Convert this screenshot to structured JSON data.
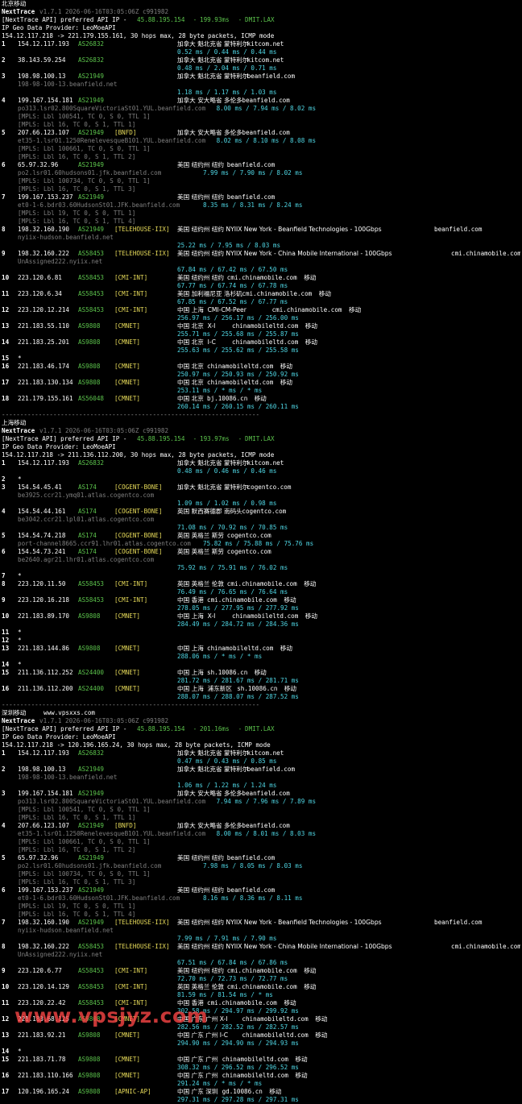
{
  "colors": {
    "green": "#5cc44c",
    "yellow": "#e8dc5a",
    "cyan": "#4fd6e4",
    "gray": "#7f7f7f",
    "red_watermark": "#ff4646"
  },
  "watermark": "www.vpsjyz.com",
  "sections": [
    {
      "title": "北京移动",
      "title_extra": "",
      "header_ver": "v1.7.1 2026-06-16T03:05:06Z c991982",
      "api_ip": "45.88.195.154",
      "api_ms": "199.93ms",
      "api_loc": "DMIT.LAX",
      "provider": "IP Geo Data Provider: LeoMoeAPI",
      "trace": "154.12.117.218 -> 221.179.155.161, 30 hops max, 28 byte packets, ICMP mode",
      "hops": [
        {
          "n": "1",
          "ip": "154.12.117.193",
          "as": "AS26832",
          "tag": "",
          "geo": "加拿大 魁北克省 蒙特利尔",
          "host": "kitcom.net",
          "isp": "",
          "rtt": "0.52 ms / 0.44 ms / 0.44 ms",
          "extra": []
        },
        {
          "n": "2",
          "ip": "38.143.59.254",
          "as": "AS26832",
          "tag": "",
          "geo": "加拿大 魁北克省 蒙特利尔",
          "host": "kitcom.net",
          "isp": "",
          "rtt": "0.48 ms / 2.04 ms / 0.71 ms",
          "extra": []
        },
        {
          "n": "3",
          "ip": "198.98.100.13",
          "as": "AS21949",
          "tag": "",
          "geo": "加拿大 魁北克省 蒙特利尔",
          "host": "beanfield.com",
          "isp": "",
          "rtt": "1.18 ms / 1.17 ms / 1.03 ms",
          "rdns": "198-98-100-13.beanfield.net",
          "extra": []
        },
        {
          "n": "4",
          "ip": "199.167.154.181",
          "as": "AS21949",
          "tag": "",
          "geo": "加拿大 安大略省 多伦多",
          "host": "beanfield.com",
          "isp": "",
          "rtt": "8.00 ms / 7.94 ms / 8.02 ms",
          "rdns": "po313.lsr02.800SquareVictoriaSt01.YUL.beanfield.com",
          "rtt_inline": true,
          "extra": [
            "[MPLS: Lbl 100541, TC 0, S 0, TTL 1]",
            "[MPLS: Lbl 16, TC 0, S 1, TTL 1]"
          ]
        },
        {
          "n": "5",
          "ip": "207.66.123.107",
          "as": "AS21949",
          "tag": "[BNFD]",
          "geo": "加拿大 安大略省 多伦多",
          "host": "beanfield.com",
          "isp": "",
          "rtt": "8.02 ms / 8.10 ms / 8.08 ms",
          "rdns": "et35-1.lsr01.1250RenelevesqueB101.YUL.beanfield.com",
          "rtt_inline": true,
          "extra": [
            "[MPLS: Lbl 100661, TC 0, S 0, TTL 1]",
            "[MPLS: Lbl 16, TC 0, S 1, TTL 2]"
          ]
        },
        {
          "n": "6",
          "ip": "65.97.32.96",
          "as": "AS21949",
          "tag": "",
          "geo": "美国 纽约州 纽约",
          "host": "beanfield.com",
          "isp": "",
          "rtt": "7.99 ms / 7.90 ms / 8.02 ms",
          "rdns": "po2.lsr01.60hudsons01.jfk.beanfield.com",
          "rtt_inline": true,
          "extra": [
            "[MPLS: Lbl 100734, TC 0, S 0, TTL 1]",
            "[MPLS: Lbl 16, TC 0, S 1, TTL 3]"
          ]
        },
        {
          "n": "7",
          "ip": "199.167.153.237",
          "as": "AS21949",
          "tag": "",
          "geo": "美国 纽约州 纽约",
          "host": "beanfield.com",
          "isp": "",
          "rtt": "8.35 ms / 8.31 ms / 8.24 ms",
          "rdns": "et0-1-6.bdr03.60HudsonSt01.JFK.beanfield.com",
          "rtt_inline": true,
          "extra": [
            "[MPLS: Lbl 19, TC 0, S 0, TTL 1]",
            "[MPLS: Lbl 16, TC 0, S 1, TTL 4]"
          ]
        },
        {
          "n": "8",
          "ip": "198.32.160.190",
          "as": "AS21949",
          "tag": "[TELEHOUSE-IIX]",
          "geo": "美国 纽约州 纽约 NYIIX New York - Beanfield Technologies - 100Gbps",
          "host": "beanfield.com",
          "isp": "",
          "rtt": "25.22 ms / 7.95 ms / 8.03 ms",
          "rdns": "nyiix-hudson.beanfield.net",
          "extra": []
        },
        {
          "n": "9",
          "ip": "198.32.160.222",
          "as": "AS58453",
          "tag": "[TELEHOUSE-IIX]",
          "geo": "美国 纽约州 纽约 NYIIX New York - China Mobile International - 100Gbps",
          "host": "cmi.chinamobile.com",
          "isp": "",
          "rtt": "67.84 ms / 67.42 ms / 67.50 ms",
          "rdns": "UnAssigned222.nyiix.net",
          "extra": []
        },
        {
          "n": "10",
          "ip": "223.120.6.81",
          "as": "AS58453",
          "tag": "[CMI-INT]",
          "geo": "美国 纽约州 纽约",
          "host": "cmi.chinamobile.com",
          "isp": "移动",
          "rtt": "67.77 ms / 67.74 ms / 67.78 ms",
          "extra": []
        },
        {
          "n": "11",
          "ip": "223.120.6.34",
          "as": "AS58453",
          "tag": "[CMI-INT]",
          "geo": "美国 加利福尼亚 洛杉矶",
          "host": "cmi.chinamobile.com",
          "isp": "移动",
          "rtt": "67.85 ms / 67.52 ms / 67.77 ms",
          "extra": []
        },
        {
          "n": "12",
          "ip": "223.120.12.214",
          "as": "AS58453",
          "tag": "[CMI-INT]",
          "geo": "中国 上海  CMI-CM-Peer",
          "host": "cmi.chinamobile.com",
          "isp": "移动",
          "rtt": "256.97 ms / 256.17 ms / 256.00 ms",
          "extra": []
        },
        {
          "n": "13",
          "ip": "221.183.55.110",
          "as": "AS9808",
          "tag": "[CMNET]",
          "geo": "中国 北京  X-I",
          "host": "chinamobileltd.com",
          "isp": "移动",
          "rtt": "255.71 ms / 255.68 ms / 255.87 ms",
          "extra": []
        },
        {
          "n": "14",
          "ip": "221.183.25.201",
          "as": "AS9808",
          "tag": "[CMNET]",
          "geo": "中国 北京  I-C",
          "host": "chinamobileltd.com",
          "isp": "移动",
          "rtt": "255.63 ms / 255.62 ms / 255.58 ms",
          "extra": []
        },
        {
          "n": "15",
          "star": true
        },
        {
          "n": "16",
          "ip": "221.183.46.174",
          "as": "AS9808",
          "tag": "[CMNET]",
          "geo": "中国 北京",
          "host": "chinamobileltd.com",
          "isp": "移动",
          "rtt": "250.97 ms / 250.93 ms / 250.92 ms",
          "extra": []
        },
        {
          "n": "17",
          "ip": "221.183.130.134",
          "as": "AS9808",
          "tag": "[CMNET]",
          "geo": "中国 北京",
          "host": "chinamobileltd.com",
          "isp": "移动",
          "rtt": "253.11 ms / * ms / * ms",
          "extra": []
        },
        {
          "n": "18",
          "ip": "221.179.155.161",
          "as": "AS56048",
          "tag": "[CMNET]",
          "geo": "中国 北京",
          "host": "bj.10086.cn",
          "isp": "移动",
          "rtt": "260.14 ms / 260.15 ms / 260.11 ms",
          "extra": []
        }
      ]
    },
    {
      "title": "上海移动",
      "title_extra": "",
      "header_ver": "v1.7.1 2026-06-16T03:05:06Z c991982",
      "api_ip": "45.88.195.154",
      "api_ms": "193.97ms",
      "api_loc": "DMIT.LAX",
      "provider": "IP Geo Data Provider: LeoMoeAPI",
      "trace": "154.12.117.218 -> 211.136.112.200, 30 hops max, 28 byte packets, ICMP mode",
      "hops": [
        {
          "n": "1",
          "ip": "154.12.117.193",
          "as": "AS26832",
          "tag": "",
          "geo": "加拿大 魁北克省 蒙特利尔",
          "host": "kitcom.net",
          "isp": "",
          "rtt": "0.48 ms / 0.46 ms / 0.46 ms",
          "extra": []
        },
        {
          "n": "2",
          "star": true
        },
        {
          "n": "3",
          "ip": "154.54.45.41",
          "as": "AS174",
          "tag": "[COGENT-BONE]",
          "geo": "加拿大 魁北克省 蒙特利尔",
          "host": "cogentco.com",
          "isp": "",
          "rtt": "1.09 ms / 1.02 ms / 0.98 ms",
          "rdns": "be3925.ccr21.ymq01.atlas.cogentco.com",
          "extra": []
        },
        {
          "n": "4",
          "ip": "154.54.44.161",
          "as": "AS174",
          "tag": "[COGENT-BONE]",
          "geo": "英国 默西赛德郡 南码头",
          "host": "cogentco.com",
          "isp": "",
          "rtt": "71.08 ms / 70.92 ms / 70.85 ms",
          "rdns": "be3042.ccr21.lpl01.atlas.cogentco.com",
          "extra": []
        },
        {
          "n": "5",
          "ip": "154.54.74.218",
          "as": "AS174",
          "tag": "[COGENT-BONE]",
          "geo": "英国 英格兰 斯劳",
          "host": "cogentco.com",
          "isp": "",
          "rtt": "75.82 ms / 75.88 ms / 75.76 ms",
          "rdns": "port-channel8665.ccr91.lhr01.atlas.cogentco.com",
          "rtt_inline": true,
          "extra": []
        },
        {
          "n": "6",
          "ip": "154.54.73.241",
          "as": "AS174",
          "tag": "[COGENT-BONE]",
          "geo": "英国 英格兰 斯劳",
          "host": "cogentco.com",
          "isp": "",
          "rtt": "75.92 ms / 75.91 ms / 76.02 ms",
          "rdns": "be2640.agr21.lhr01.atlas.cogentco.com",
          "extra": []
        },
        {
          "n": "7",
          "star": true
        },
        {
          "n": "8",
          "ip": "223.120.11.50",
          "as": "AS58453",
          "tag": "[CMI-INT]",
          "geo": "英国 英格兰 伦敦",
          "host": "cmi.chinamobile.com",
          "isp": "移动",
          "rtt": "76.49 ms / 76.65 ms / 76.64 ms",
          "extra": []
        },
        {
          "n": "9",
          "ip": "223.120.16.218",
          "as": "AS58453",
          "tag": "[CMI-INT]",
          "geo": "中国 香港",
          "host": "cmi.chinamobile.com",
          "isp": "移动",
          "rtt": "278.05 ms / 277.95 ms / 277.92 ms",
          "extra": []
        },
        {
          "n": "10",
          "ip": "221.183.89.170",
          "as": "AS9808",
          "tag": "[CMNET]",
          "geo": "中国 上海  X-I",
          "host": "chinamobileltd.com",
          "isp": "移动",
          "rtt": "284.49 ms / 284.72 ms / 284.36 ms",
          "extra": []
        },
        {
          "n": "11",
          "star": true
        },
        {
          "n": "12",
          "star": true
        },
        {
          "n": "13",
          "ip": "221.183.144.86",
          "as": "AS9808",
          "tag": "[CMNET]",
          "geo": "中国 上海",
          "host": "chinamobileltd.com",
          "isp": "移动",
          "rtt": "288.06 ms / * ms / * ms",
          "extra": []
        },
        {
          "n": "14",
          "star": true
        },
        {
          "n": "15",
          "ip": "211.136.112.252",
          "as": "AS24400",
          "tag": "[CMNET]",
          "geo": "中国 上海",
          "host": "sh.10086.cn",
          "isp": "移动",
          "rtt": "281.72 ms / 281.67 ms / 281.71 ms",
          "extra": []
        },
        {
          "n": "16",
          "ip": "211.136.112.200",
          "as": "AS24400",
          "tag": "[CMNET]",
          "geo": "中国 上海  浦东新区",
          "host": "sh.10086.cn",
          "isp": "移动",
          "rtt": "288.07 ms / 288.07 ms / 287.52 ms",
          "extra": []
        }
      ]
    },
    {
      "title": "深圳移动",
      "title_extra": "www.vpsxxs.com",
      "header_ver": "v1.7.1 2026-06-16T03:05:06Z c991982",
      "api_ip": "45.88.195.154",
      "api_ms": "201.16ms",
      "api_loc": "DMIT.LAX",
      "provider": "IP Geo Data Provider: LeoMoeAPI",
      "trace": "154.12.117.218 -> 120.196.165.24, 30 hops max, 28 byte packets, ICMP mode",
      "hops": [
        {
          "n": "1",
          "ip": "154.12.117.193",
          "as": "AS26832",
          "tag": "",
          "geo": "加拿大 魁北克省 蒙特利尔",
          "host": "kitcom.net",
          "isp": "",
          "rtt": "0.47 ms / 0.43 ms / 0.85 ms",
          "extra": []
        },
        {
          "n": "2",
          "ip": "198.98.100.13",
          "as": "AS21949",
          "tag": "",
          "geo": "加拿大 魁北克省 蒙特利尔",
          "host": "beanfield.com",
          "isp": "",
          "rtt": "1.06 ms / 1.22 ms / 1.24 ms",
          "rdns": "198-98-100-13.beanfield.net",
          "extra": []
        },
        {
          "n": "3",
          "ip": "199.167.154.181",
          "as": "AS21949",
          "tag": "",
          "geo": "加拿大 安大略省 多伦多",
          "host": "beanfield.com",
          "isp": "",
          "rtt": "7.94 ms / 7.96 ms / 7.89 ms",
          "rdns": "po313.lsr02.800SquareVictoriaSt01.YUL.beanfield.com",
          "rtt_inline": true,
          "extra": [
            "[MPLS: Lbl 100541, TC 0, S 0, TTL 1]",
            "[MPLS: Lbl 16, TC 0, S 1, TTL 1]"
          ]
        },
        {
          "n": "4",
          "ip": "207.66.123.107",
          "as": "AS21949",
          "tag": "[BNFD]",
          "geo": "加拿大 安大略省 多伦多",
          "host": "beanfield.com",
          "isp": "",
          "rtt": "8.00 ms / 8.01 ms / 8.03 ms",
          "rdns": "et35-1.lsr01.1250RenelevesqueB101.YUL.beanfield.com",
          "rtt_inline": true,
          "extra": [
            "[MPLS: Lbl 100661, TC 0, S 0, TTL 1]",
            "[MPLS: Lbl 16, TC 0, S 1, TTL 2]"
          ]
        },
        {
          "n": "5",
          "ip": "65.97.32.96",
          "as": "AS21949",
          "tag": "",
          "geo": "美国 纽约州 纽约",
          "host": "beanfield.com",
          "isp": "",
          "rtt": "7.98 ms / 8.05 ms / 8.03 ms",
          "rdns": "po2.lsr01.60hudsons01.jfk.beanfield.com",
          "rtt_inline": true,
          "extra": [
            "[MPLS: Lbl 100734, TC 0, S 0, TTL 1]",
            "[MPLS: Lbl 16, TC 0, S 1, TTL 3]"
          ]
        },
        {
          "n": "6",
          "ip": "199.167.153.237",
          "as": "AS21949",
          "tag": "",
          "geo": "美国 纽约州 纽约",
          "host": "beanfield.com",
          "isp": "",
          "rtt": "8.16 ms / 8.36 ms / 8.11 ms",
          "rdns": "et0-1-6.bdr03.60HudsonSt01.JFK.beanfield.com",
          "rtt_inline": true,
          "extra": [
            "[MPLS: Lbl 19, TC 0, S 0, TTL 1]",
            "[MPLS: Lbl 16, TC 0, S 1, TTL 4]"
          ]
        },
        {
          "n": "7",
          "ip": "198.32.160.190",
          "as": "AS21949",
          "tag": "[TELEHOUSE-IIX]",
          "geo": "美国 纽约州 纽约 NYIIX New York - Beanfield Technologies - 100Gbps",
          "host": "beanfield.com",
          "isp": "",
          "rtt": "7.99 ms / 7.91 ms / 7.90 ms",
          "rdns": "nyiix-hudson.beanfield.net",
          "extra": []
        },
        {
          "n": "8",
          "ip": "198.32.160.222",
          "as": "AS58453",
          "tag": "[TELEHOUSE-IIX]",
          "geo": "美国 纽约州 纽约 NYIIX New York - China Mobile International - 100Gbps",
          "host": "cmi.chinamobile.com",
          "isp": "",
          "rtt": "67.51 ms / 67.84 ms / 67.86 ms",
          "rdns": "UnAssigned222.nyiix.net",
          "extra": []
        },
        {
          "n": "9",
          "ip": "223.120.6.77",
          "as": "AS58453",
          "tag": "[CMI-INT]",
          "geo": "美国 纽约州 纽约",
          "host": "cmi.chinamobile.com",
          "isp": "移动",
          "rtt": "72.70 ms / 72.73 ms / 72.77 ms",
          "extra": []
        },
        {
          "n": "10",
          "ip": "223.120.14.129",
          "as": "AS58453",
          "tag": "[CMI-INT]",
          "geo": "英国 英格兰 伦敦",
          "host": "cmi.chinamobile.com",
          "isp": "移动",
          "rtt": "81.59 ms / 81.54 ms / * ms",
          "extra": []
        },
        {
          "n": "11",
          "ip": "223.120.22.42",
          "as": "AS58453",
          "tag": "[CMI-INT]",
          "geo": "中国 香港",
          "host": "cmi.chinamobile.com",
          "isp": "移动",
          "rtt": "302.58 ms / 294.97 ms / 299.92 ms",
          "extra": []
        },
        {
          "n": "12",
          "ip": "221.183.68.125",
          "as": "AS9808",
          "tag": "[CMNET]",
          "geo": "中国 广东 广州 X-I",
          "host": "chinamobileltd.com",
          "isp": "移动",
          "rtt": "282.56 ms / 282.52 ms / 282.57 ms",
          "extra": []
        },
        {
          "n": "13",
          "ip": "221.183.92.21",
          "as": "AS9808",
          "tag": "[CMNET]",
          "geo": "中国 广东 广州 I-C",
          "host": "chinamobileltd.com",
          "isp": "移动",
          "rtt": "294.90 ms / 294.90 ms / 294.93 ms",
          "extra": []
        },
        {
          "n": "14",
          "star": true
        },
        {
          "n": "15",
          "ip": "221.183.71.78",
          "as": "AS9808",
          "tag": "[CMNET]",
          "geo": "中国 广东 广州",
          "host": "chinamobileltd.com",
          "isp": "移动",
          "rtt": "308.32 ms / 296.52 ms / 296.52 ms",
          "extra": []
        },
        {
          "n": "16",
          "ip": "221.183.110.166",
          "as": "AS9808",
          "tag": "[CMNET]",
          "geo": "中国 广东 广州",
          "host": "chinamobileltd.com",
          "isp": "移动",
          "rtt": "291.24 ms / * ms / * ms",
          "extra": []
        },
        {
          "n": "17",
          "ip": "120.196.165.24",
          "as": "AS9808",
          "tag": "[APNIC-AP]",
          "geo": "中国 广东 深圳",
          "host": "gd.10086.cn",
          "isp": "移动",
          "rtt": "297.31 ms / 297.28 ms / 297.31 ms",
          "extra": []
        }
      ]
    }
  ]
}
